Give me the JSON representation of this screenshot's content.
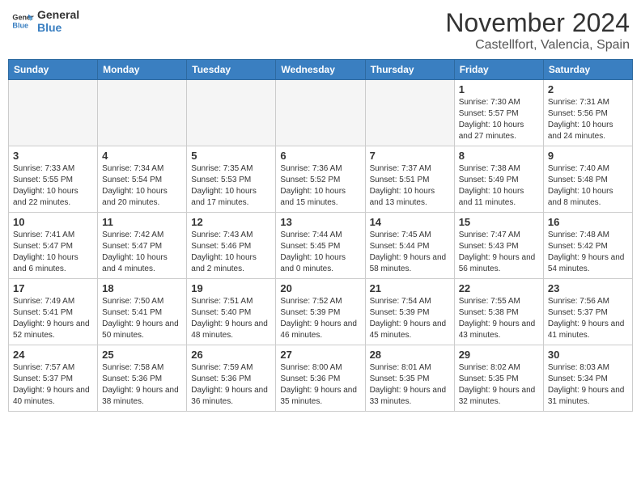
{
  "header": {
    "logo_general": "General",
    "logo_blue": "Blue",
    "month": "November 2024",
    "location": "Castellfort, Valencia, Spain"
  },
  "days_of_week": [
    "Sunday",
    "Monday",
    "Tuesday",
    "Wednesday",
    "Thursday",
    "Friday",
    "Saturday"
  ],
  "weeks": [
    [
      {
        "day": "",
        "info": ""
      },
      {
        "day": "",
        "info": ""
      },
      {
        "day": "",
        "info": ""
      },
      {
        "day": "",
        "info": ""
      },
      {
        "day": "",
        "info": ""
      },
      {
        "day": "1",
        "info": "Sunrise: 7:30 AM\nSunset: 5:57 PM\nDaylight: 10 hours and 27 minutes."
      },
      {
        "day": "2",
        "info": "Sunrise: 7:31 AM\nSunset: 5:56 PM\nDaylight: 10 hours and 24 minutes."
      }
    ],
    [
      {
        "day": "3",
        "info": "Sunrise: 7:33 AM\nSunset: 5:55 PM\nDaylight: 10 hours and 22 minutes."
      },
      {
        "day": "4",
        "info": "Sunrise: 7:34 AM\nSunset: 5:54 PM\nDaylight: 10 hours and 20 minutes."
      },
      {
        "day": "5",
        "info": "Sunrise: 7:35 AM\nSunset: 5:53 PM\nDaylight: 10 hours and 17 minutes."
      },
      {
        "day": "6",
        "info": "Sunrise: 7:36 AM\nSunset: 5:52 PM\nDaylight: 10 hours and 15 minutes."
      },
      {
        "day": "7",
        "info": "Sunrise: 7:37 AM\nSunset: 5:51 PM\nDaylight: 10 hours and 13 minutes."
      },
      {
        "day": "8",
        "info": "Sunrise: 7:38 AM\nSunset: 5:49 PM\nDaylight: 10 hours and 11 minutes."
      },
      {
        "day": "9",
        "info": "Sunrise: 7:40 AM\nSunset: 5:48 PM\nDaylight: 10 hours and 8 minutes."
      }
    ],
    [
      {
        "day": "10",
        "info": "Sunrise: 7:41 AM\nSunset: 5:47 PM\nDaylight: 10 hours and 6 minutes."
      },
      {
        "day": "11",
        "info": "Sunrise: 7:42 AM\nSunset: 5:47 PM\nDaylight: 10 hours and 4 minutes."
      },
      {
        "day": "12",
        "info": "Sunrise: 7:43 AM\nSunset: 5:46 PM\nDaylight: 10 hours and 2 minutes."
      },
      {
        "day": "13",
        "info": "Sunrise: 7:44 AM\nSunset: 5:45 PM\nDaylight: 10 hours and 0 minutes."
      },
      {
        "day": "14",
        "info": "Sunrise: 7:45 AM\nSunset: 5:44 PM\nDaylight: 9 hours and 58 minutes."
      },
      {
        "day": "15",
        "info": "Sunrise: 7:47 AM\nSunset: 5:43 PM\nDaylight: 9 hours and 56 minutes."
      },
      {
        "day": "16",
        "info": "Sunrise: 7:48 AM\nSunset: 5:42 PM\nDaylight: 9 hours and 54 minutes."
      }
    ],
    [
      {
        "day": "17",
        "info": "Sunrise: 7:49 AM\nSunset: 5:41 PM\nDaylight: 9 hours and 52 minutes."
      },
      {
        "day": "18",
        "info": "Sunrise: 7:50 AM\nSunset: 5:41 PM\nDaylight: 9 hours and 50 minutes."
      },
      {
        "day": "19",
        "info": "Sunrise: 7:51 AM\nSunset: 5:40 PM\nDaylight: 9 hours and 48 minutes."
      },
      {
        "day": "20",
        "info": "Sunrise: 7:52 AM\nSunset: 5:39 PM\nDaylight: 9 hours and 46 minutes."
      },
      {
        "day": "21",
        "info": "Sunrise: 7:54 AM\nSunset: 5:39 PM\nDaylight: 9 hours and 45 minutes."
      },
      {
        "day": "22",
        "info": "Sunrise: 7:55 AM\nSunset: 5:38 PM\nDaylight: 9 hours and 43 minutes."
      },
      {
        "day": "23",
        "info": "Sunrise: 7:56 AM\nSunset: 5:37 PM\nDaylight: 9 hours and 41 minutes."
      }
    ],
    [
      {
        "day": "24",
        "info": "Sunrise: 7:57 AM\nSunset: 5:37 PM\nDaylight: 9 hours and 40 minutes."
      },
      {
        "day": "25",
        "info": "Sunrise: 7:58 AM\nSunset: 5:36 PM\nDaylight: 9 hours and 38 minutes."
      },
      {
        "day": "26",
        "info": "Sunrise: 7:59 AM\nSunset: 5:36 PM\nDaylight: 9 hours and 36 minutes."
      },
      {
        "day": "27",
        "info": "Sunrise: 8:00 AM\nSunset: 5:36 PM\nDaylight: 9 hours and 35 minutes."
      },
      {
        "day": "28",
        "info": "Sunrise: 8:01 AM\nSunset: 5:35 PM\nDaylight: 9 hours and 33 minutes."
      },
      {
        "day": "29",
        "info": "Sunrise: 8:02 AM\nSunset: 5:35 PM\nDaylight: 9 hours and 32 minutes."
      },
      {
        "day": "30",
        "info": "Sunrise: 8:03 AM\nSunset: 5:34 PM\nDaylight: 9 hours and 31 minutes."
      }
    ]
  ]
}
